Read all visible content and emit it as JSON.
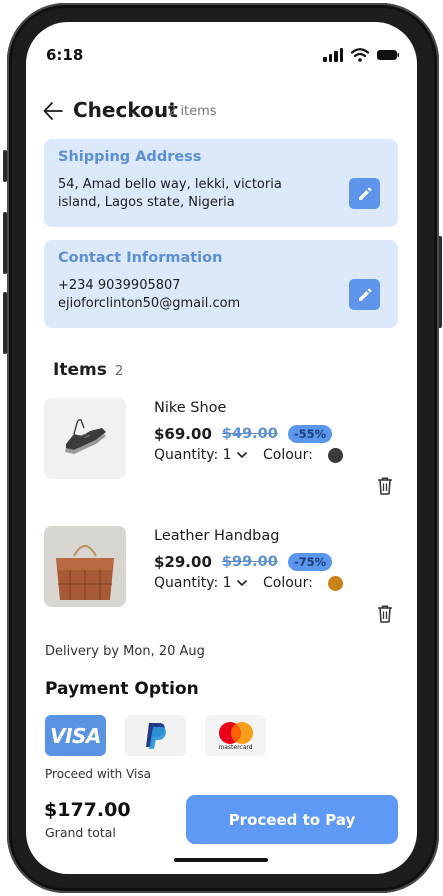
{
  "status_bar": {
    "time": "6:18"
  },
  "header": {
    "title": "Checkout",
    "item_count": "2 items"
  },
  "shipping": {
    "title": "Shipping Address",
    "line1": "54, Amad bello way, lekki, victoria",
    "line2": "island, Lagos state, Nigeria"
  },
  "contact": {
    "title": "Contact Information",
    "phone": "+234 9039905807",
    "email": "ejioforclinton50@gmail.com"
  },
  "items_section": {
    "title": "Items",
    "count": "2"
  },
  "items": [
    {
      "name": "Nike Shoe",
      "price": "$69.00",
      "old_price": "$49.00",
      "discount": "-55%",
      "quantity_label": "Quantity: 1",
      "colour_label": "Colour:",
      "colour": "#3a3a3a",
      "icon": "sneaker-image"
    },
    {
      "name": "Leather Handbag",
      "price": "$29.00",
      "old_price": "$99.00",
      "discount": "-75%",
      "quantity_label": "Quantity: 1",
      "colour_label": "Colour:",
      "colour": "#c8821a",
      "icon": "handbag-image"
    }
  ],
  "delivery": "Delivery by Mon, 20 Aug",
  "payment": {
    "title": "Payment Option",
    "options": [
      "VISA",
      "PayPal",
      "mastercard"
    ],
    "note": "Proceed with Visa"
  },
  "footer": {
    "total": "$177.00",
    "total_label": "Grand total",
    "button_label": "Proceed to Pay"
  },
  "colors": {
    "accent": "#5e9af5",
    "card_bg": "#dce9fb",
    "card_title": "#5d8fd4"
  }
}
